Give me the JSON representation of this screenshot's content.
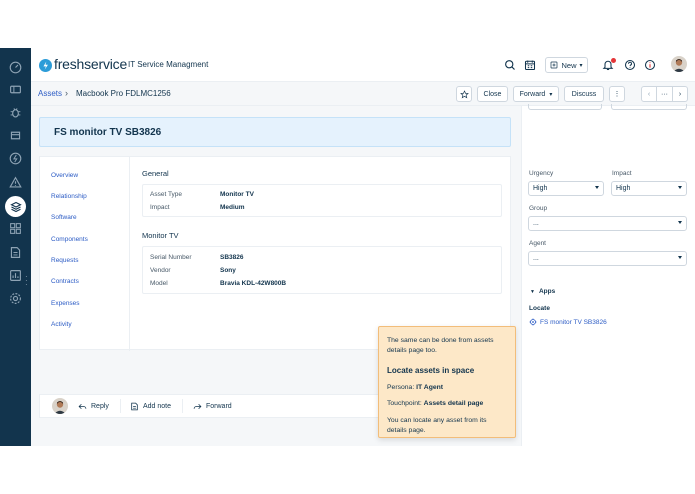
{
  "header": {
    "logo_text": "freshservice",
    "app_name": "IT Service Managment",
    "new_label": "New"
  },
  "breadcrumb": {
    "parent": "Assets",
    "separator": "›",
    "current": "Macbook Pro FDLMC1256"
  },
  "toolbar": {
    "close_label": "Close",
    "forward_label": "Forward",
    "discuss_label": "Discuss",
    "more_label": "⋮",
    "ellipsis_label": "···"
  },
  "asset": {
    "title": "FS monitor TV SB3826"
  },
  "tabs": [
    "Overview",
    "Relationship",
    "Software",
    "Components",
    "Requests",
    "Contracts",
    "Expenses",
    "Activity"
  ],
  "general": {
    "heading": "General",
    "fields": [
      {
        "label": "Asset Type",
        "value": "Monitor TV"
      },
      {
        "label": "Impact",
        "value": "Medium"
      }
    ]
  },
  "monitor": {
    "heading": "Monitor TV",
    "fields": [
      {
        "label": "Serial Number",
        "value": "SB3826"
      },
      {
        "label": "Vendor",
        "value": "Sony"
      },
      {
        "label": "Model",
        "value": "Bravia KDL-42W800B"
      }
    ]
  },
  "reply_bar": {
    "reply_label": "Reply",
    "add_note_label": "Add note",
    "forward_label": "Forward"
  },
  "right_panel": {
    "urgency_label": "Urgency",
    "urgency_value": "High",
    "impact_label": "Impact",
    "impact_value": "High",
    "group_label": "Group",
    "group_value": "...",
    "agent_label": "Agent",
    "agent_value": "...",
    "apps_label": "Apps",
    "locate_label": "Locate",
    "locate_link": "FS monitor TV SB3826"
  },
  "tooltip": {
    "intro": "The same can be done from assets details page too.",
    "title": "Locate assets in space",
    "persona_label": "Persona:",
    "persona_value": "IT Agent",
    "touchpoint_label": "Touchpoint:",
    "touchpoint_value": "Assets detail page",
    "body": "You can locate any asset from its details page."
  },
  "colors": {
    "rail": "#12344d",
    "link": "#2c5cc5",
    "title_card": "#e5f2fd",
    "tooltip_bg": "#fde8c8",
    "notification": "#e43538"
  }
}
